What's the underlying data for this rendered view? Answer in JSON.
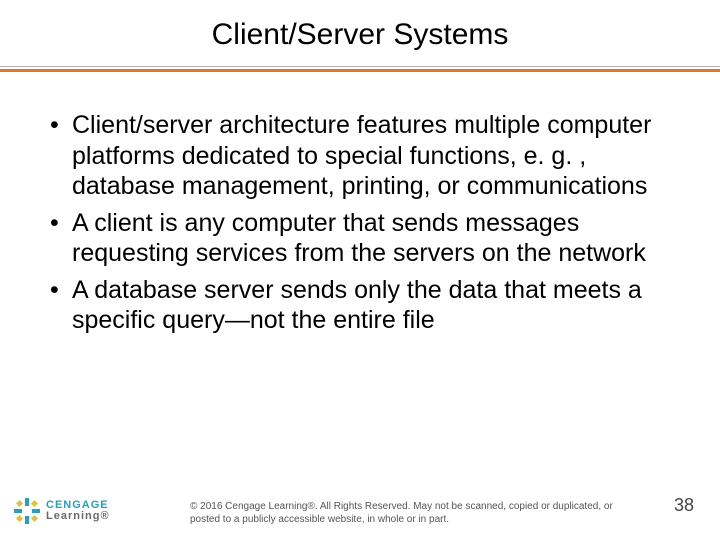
{
  "title": "Client/Server Systems",
  "bullets": [
    "Client/server architecture features multiple computer platforms dedicated to special functions, e. g. , database management, printing, or communications",
    "A client is any computer that sends messages requesting services from the servers on the network",
    "A database server sends only the data that meets a specific query—not the entire file"
  ],
  "logo": {
    "line1": "CENGAGE",
    "line2": "Learning®"
  },
  "copyright": "© 2016 Cengage Learning®. All Rights Reserved. May not be scanned, copied or duplicated, or posted to a publicly accessible website, in whole or in part.",
  "page_number": "38",
  "colors": {
    "accent": "#d97a2a",
    "logo_primary": "#2aa0b8"
  }
}
